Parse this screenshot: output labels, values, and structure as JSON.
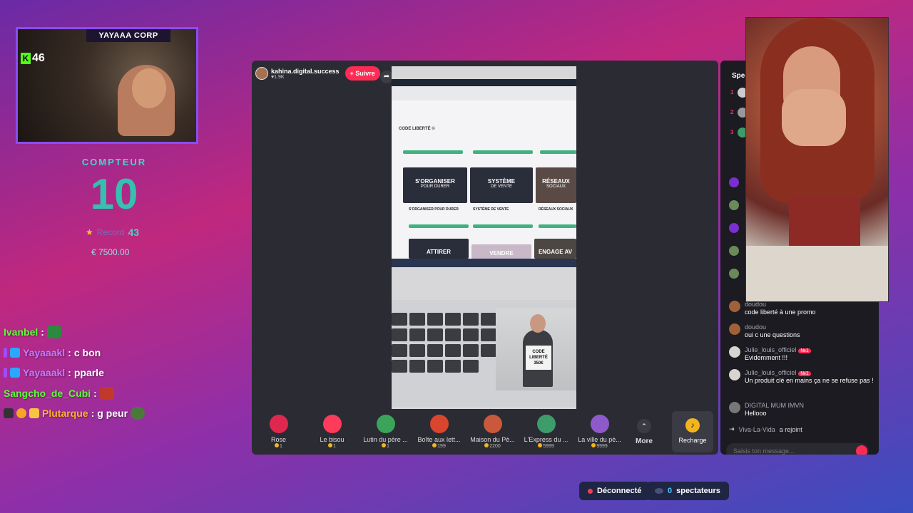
{
  "streamer_cam": {
    "title": "YAYAAA CORP",
    "kick_count": "46"
  },
  "counter": {
    "label": "COMPTEUR",
    "value": "10",
    "record_label": "Record",
    "record_value": "43",
    "money": "€ 7500.00"
  },
  "chat_overlay": [
    {
      "name": "Ivanbel",
      "sep": " :",
      "text": "",
      "name_color": "green"
    },
    {
      "name": "Yayaaakl",
      "sep": " :",
      "text": " c bon",
      "name_color": "purple"
    },
    {
      "name": "Yayaaakl",
      "sep": " :",
      "text": " pparle",
      "name_color": "purple"
    },
    {
      "name": "Sangcho_de_Cubi",
      "sep": " :",
      "text": "",
      "name_color": "green"
    },
    {
      "name": "Plutarque",
      "sep": " :",
      "text": " g peur",
      "name_color": "orange"
    }
  ],
  "tiktok": {
    "host_name": "kahina.digital.success",
    "host_likes": "♥1.9K",
    "follow_label": "+ Suivre",
    "video": {
      "brand": "CODE LIBERTÉ ©",
      "tiles": [
        {
          "title": "S'ORGANISER",
          "sub": "POUR DURER",
          "label": "S'ORGANISER POUR DURER"
        },
        {
          "title": "SYSTÈME",
          "sub": "DE VENTE",
          "label": "SYSTÈME DE VENTE"
        },
        {
          "title": "RÉSEAUX",
          "sub": "SOCIAUX",
          "label": "RÉSEAUX SOCIAUX"
        }
      ],
      "bottom_tiles": [
        "ATTIRER",
        "VENDRE",
        "ENGAGE AV"
      ],
      "ad_sign": "CODE LIBERTÉ 350€"
    },
    "gifts": [
      {
        "name": "Rose",
        "price": "1",
        "color": "#e0284f"
      },
      {
        "name": "Le bisou",
        "price": "1",
        "color": "#ff3b5c"
      },
      {
        "name": "Lutin du père ...",
        "price": "1",
        "color": "#3aa45a"
      },
      {
        "name": "Boîte aux lett...",
        "price": "199",
        "color": "#d9462d"
      },
      {
        "name": "Maison du Pè...",
        "price": "2200",
        "color": "#c9593a"
      },
      {
        "name": "L'Express du ...",
        "price": "5999",
        "color": "#3c9c6a"
      },
      {
        "name": "La ville du pè...",
        "price": "9999",
        "color": "#8e5acb"
      }
    ],
    "more_label": "More",
    "recharge_label": "Recharge"
  },
  "side_chat": {
    "header": "Spec",
    "ranks": [
      "1",
      "2",
      "3"
    ],
    "messages": [
      {
        "name": "doudou",
        "text": "code liberté à une promo",
        "tag": "",
        "avatar": "#a0603a"
      },
      {
        "name": "doudou",
        "text": "oui c une questions",
        "tag": "",
        "avatar": "#a0603a"
      },
      {
        "name": "Julie_louis_officiel",
        "text": "Evidemment !!!",
        "tag": "№1",
        "avatar": "#d9d4cf"
      },
      {
        "name": "Julie_louis_officiel",
        "text": "Un produit clé en mains ça ne se refuse pas !",
        "tag": "№1",
        "avatar": "#d9d4cf"
      },
      {
        "name": "DIGITAL MUM IMVN",
        "text": "Hellooo",
        "tag": "",
        "avatar": "#777"
      }
    ],
    "joined_user": "Viva-La-Vida",
    "joined_text": "a rejoint",
    "input_placeholder": "Saisis ton message..."
  },
  "status_bar": {
    "connection": "Déconnecté",
    "viewers_count": "0",
    "viewers_label": "spectateurs"
  }
}
